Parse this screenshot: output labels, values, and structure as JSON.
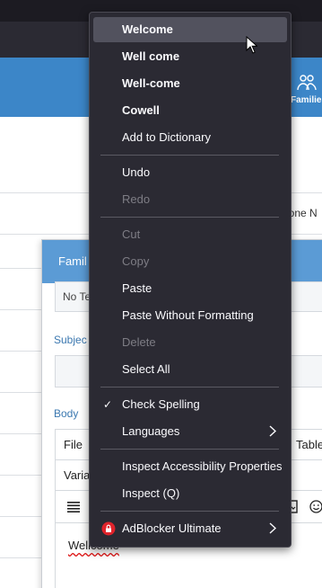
{
  "background": {
    "nav_families_label": "Families",
    "phone_column_partial": "hone N",
    "modal": {
      "title_partial": "Famil",
      "no_text_partial": "No Te",
      "subject_label_partial": "Subjec",
      "body_label": "Body",
      "editor_menu": {
        "file": "File",
        "table_partial": "Table"
      },
      "variables_partial": "Varia",
      "body_text": "Wellcome"
    }
  },
  "context_menu": {
    "spelling_suggestions": [
      "Welcome",
      "Well come",
      "Well-come",
      "Cowell"
    ],
    "add_to_dictionary": "Add to Dictionary",
    "undo": "Undo",
    "redo": "Redo",
    "cut": "Cut",
    "copy": "Copy",
    "paste": "Paste",
    "paste_without_formatting": "Paste Without Formatting",
    "delete": "Delete",
    "select_all": "Select All",
    "check_spelling": "Check Spelling",
    "check_spelling_checked": true,
    "languages": "Languages",
    "inspect_accessibility": "Inspect Accessibility Properties",
    "inspect": "Inspect (Q)",
    "addon": "AdBlocker Ultimate"
  },
  "colors": {
    "menu_background": "#2b2a33",
    "menu_hover": "#52525e",
    "header_blue": "#3c86c8",
    "modal_header_blue": "#5b9bd5"
  }
}
